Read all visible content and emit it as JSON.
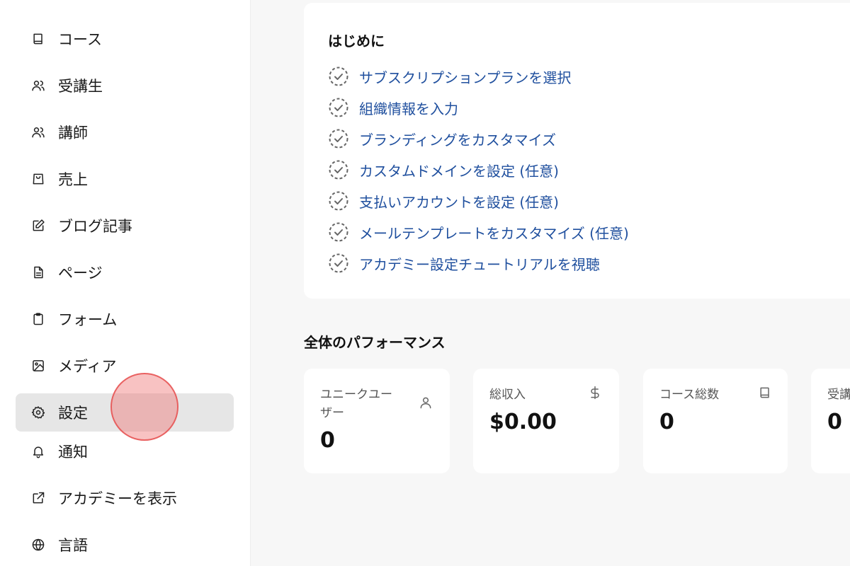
{
  "sidebar": {
    "items": [
      {
        "label": "コース",
        "icon": "book-icon"
      },
      {
        "label": "受講生",
        "icon": "users-icon"
      },
      {
        "label": "講師",
        "icon": "users-icon"
      },
      {
        "label": "売上",
        "icon": "shopping-bag-icon"
      },
      {
        "label": "ブログ記事",
        "icon": "edit-icon"
      },
      {
        "label": "ページ",
        "icon": "file-text-icon"
      },
      {
        "label": "フォーム",
        "icon": "clipboard-icon"
      },
      {
        "label": "メディア",
        "icon": "image-icon"
      },
      {
        "label": "設定",
        "icon": "gear-icon",
        "active": true
      },
      {
        "label": "通知",
        "icon": "bell-icon"
      },
      {
        "label": "アカデミーを表示",
        "icon": "external-link-icon"
      },
      {
        "label": "言語",
        "icon": "globe-icon"
      }
    ]
  },
  "getting_started": {
    "title": "はじめに",
    "steps": [
      "サブスクリプションプランを選択",
      "組織情報を入力",
      "ブランディングをカスタマイズ",
      "カスタムドメインを設定 (任意)",
      "支払いアカウントを設定 (任意)",
      "メールテンプレートをカスタマイズ (任意)",
      "アカデミー設定チュートリアルを視聴"
    ]
  },
  "performance": {
    "title": "全体のパフォーマンス",
    "stats": [
      {
        "label": "ユニークユーザー",
        "label_line1": "ユニークユー",
        "label_line2": "ザー",
        "value": "0",
        "icon": "user-icon"
      },
      {
        "label": "総収入",
        "value": "$0.00",
        "icon": "dollar-icon"
      },
      {
        "label": "コース総数",
        "value": "0",
        "icon": "book-icon"
      },
      {
        "label": "受講",
        "value": "0",
        "icon": ""
      }
    ]
  },
  "colors": {
    "link": "#1f4f9e",
    "active_bg": "#e6e6e6",
    "page_bg": "#f7f7f7"
  }
}
